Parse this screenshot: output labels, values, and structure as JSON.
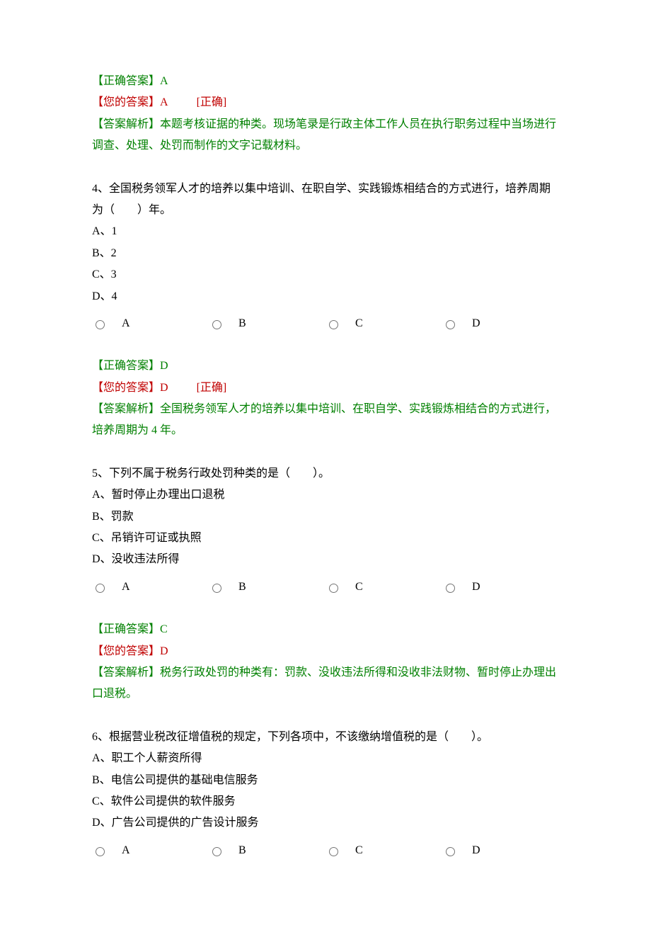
{
  "labels": {
    "correct_answer": "【正确答案】",
    "your_answer": "【您的答案】",
    "analysis": "【答案解析】",
    "status_correct": "[正确]"
  },
  "option_letters": {
    "a": "A",
    "b": "B",
    "c": "C",
    "d": "D"
  },
  "q3_answer": {
    "correct": "A",
    "yours": "A",
    "status": "[正确]",
    "analysis": "本题考核证据的种类。现场笔录是行政主体工作人员在执行职务过程中当场进行调查、处理、处罚而制作的文字记载材料。"
  },
  "q4": {
    "text": "4、全国税务领军人才的培养以集中培训、在职自学、实践锻炼相结合的方式进行，培养周期为（　　）年。",
    "opts": {
      "a": "A、1",
      "b": "B、2",
      "c": "C、3",
      "d": "D、4"
    },
    "answer": {
      "correct": "D",
      "yours": "D",
      "status": "[正确]",
      "analysis": "全国税务领军人才的培养以集中培训、在职自学、实践锻炼相结合的方式进行，培养周期为 4 年。"
    }
  },
  "q5": {
    "text": "5、下列不属于税务行政处罚种类的是（　　）。",
    "opts": {
      "a": "A、暂时停止办理出口退税",
      "b": "B、罚款",
      "c": "C、吊销许可证或执照",
      "d": "D、没收违法所得"
    },
    "answer": {
      "correct": "C",
      "yours": "D",
      "analysis": "税务行政处罚的种类有：罚款、没收违法所得和没收非法财物、暂时停止办理出口退税。"
    }
  },
  "q6": {
    "text": "6、根据营业税改征增值税的规定，下列各项中，不该缴纳增值税的是（　　）。",
    "opts": {
      "a": "A、职工个人薪资所得",
      "b": "B、电信公司提供的基础电信服务",
      "c": "C、软件公司提供的软件服务",
      "d": "D、广告公司提供的广告设计服务"
    }
  }
}
